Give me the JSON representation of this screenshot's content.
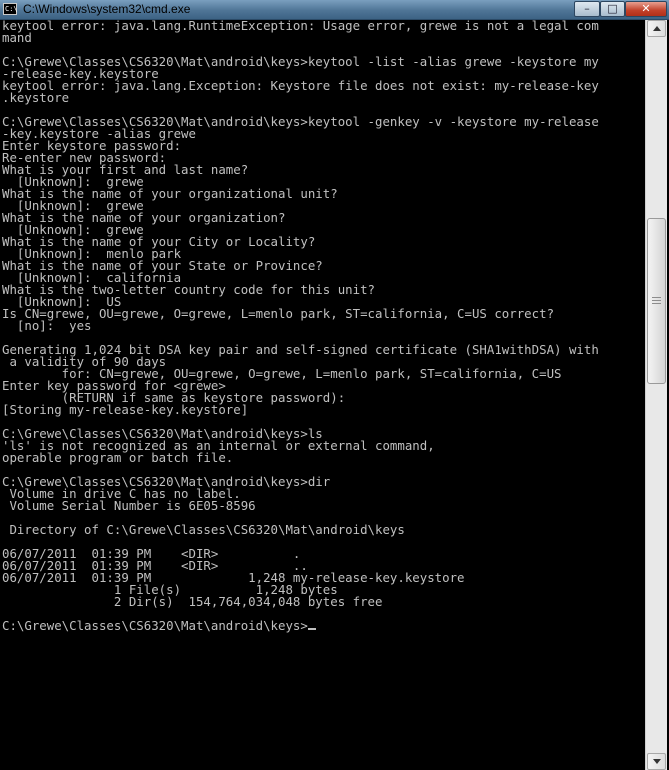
{
  "window": {
    "title": "C:\\Windows\\system32\\cmd.exe",
    "icon_label": "C:\\",
    "buttons": {
      "minimize": "–",
      "maximize": "□",
      "close": "✕"
    }
  },
  "console": {
    "lines": [
      "keytool error: java.lang.RuntimeException: Usage error, grewe is not a legal com",
      "mand",
      "",
      "C:\\Grewe\\Classes\\CS6320\\Mat\\android\\keys>keytool -list -alias grewe -keystore my",
      "-release-key.keystore",
      "keytool error: java.lang.Exception: Keystore file does not exist: my-release-key",
      ".keystore",
      "",
      "C:\\Grewe\\Classes\\CS6320\\Mat\\android\\keys>keytool -genkey -v -keystore my-release",
      "-key.keystore -alias grewe",
      "Enter keystore password:",
      "Re-enter new password:",
      "What is your first and last name?",
      "  [Unknown]:  grewe",
      "What is the name of your organizational unit?",
      "  [Unknown]:  grewe",
      "What is the name of your organization?",
      "  [Unknown]:  grewe",
      "What is the name of your City or Locality?",
      "  [Unknown]:  menlo park",
      "What is the name of your State or Province?",
      "  [Unknown]:  california",
      "What is the two-letter country code for this unit?",
      "  [Unknown]:  US",
      "Is CN=grewe, OU=grewe, O=grewe, L=menlo park, ST=california, C=US correct?",
      "  [no]:  yes",
      "",
      "Generating 1,024 bit DSA key pair and self-signed certificate (SHA1withDSA) with",
      " a validity of 90 days",
      "        for: CN=grewe, OU=grewe, O=grewe, L=menlo park, ST=california, C=US",
      "Enter key password for <grewe>",
      "        (RETURN if same as keystore password):",
      "[Storing my-release-key.keystore]",
      "",
      "C:\\Grewe\\Classes\\CS6320\\Mat\\android\\keys>ls",
      "'ls' is not recognized as an internal or external command,",
      "operable program or batch file.",
      "",
      "C:\\Grewe\\Classes\\CS6320\\Mat\\android\\keys>dir",
      " Volume in drive C has no label.",
      " Volume Serial Number is 6E05-8596",
      "",
      " Directory of C:\\Grewe\\Classes\\CS6320\\Mat\\android\\keys",
      "",
      "06/07/2011  01:39 PM    <DIR>          .",
      "06/07/2011  01:39 PM    <DIR>          ..",
      "06/07/2011  01:39 PM             1,248 my-release-key.keystore",
      "               1 File(s)          1,248 bytes",
      "               2 Dir(s)  154,764,034,048 bytes free",
      "",
      "C:\\Grewe\\Classes\\CS6320\\Mat\\android\\keys>"
    ]
  }
}
